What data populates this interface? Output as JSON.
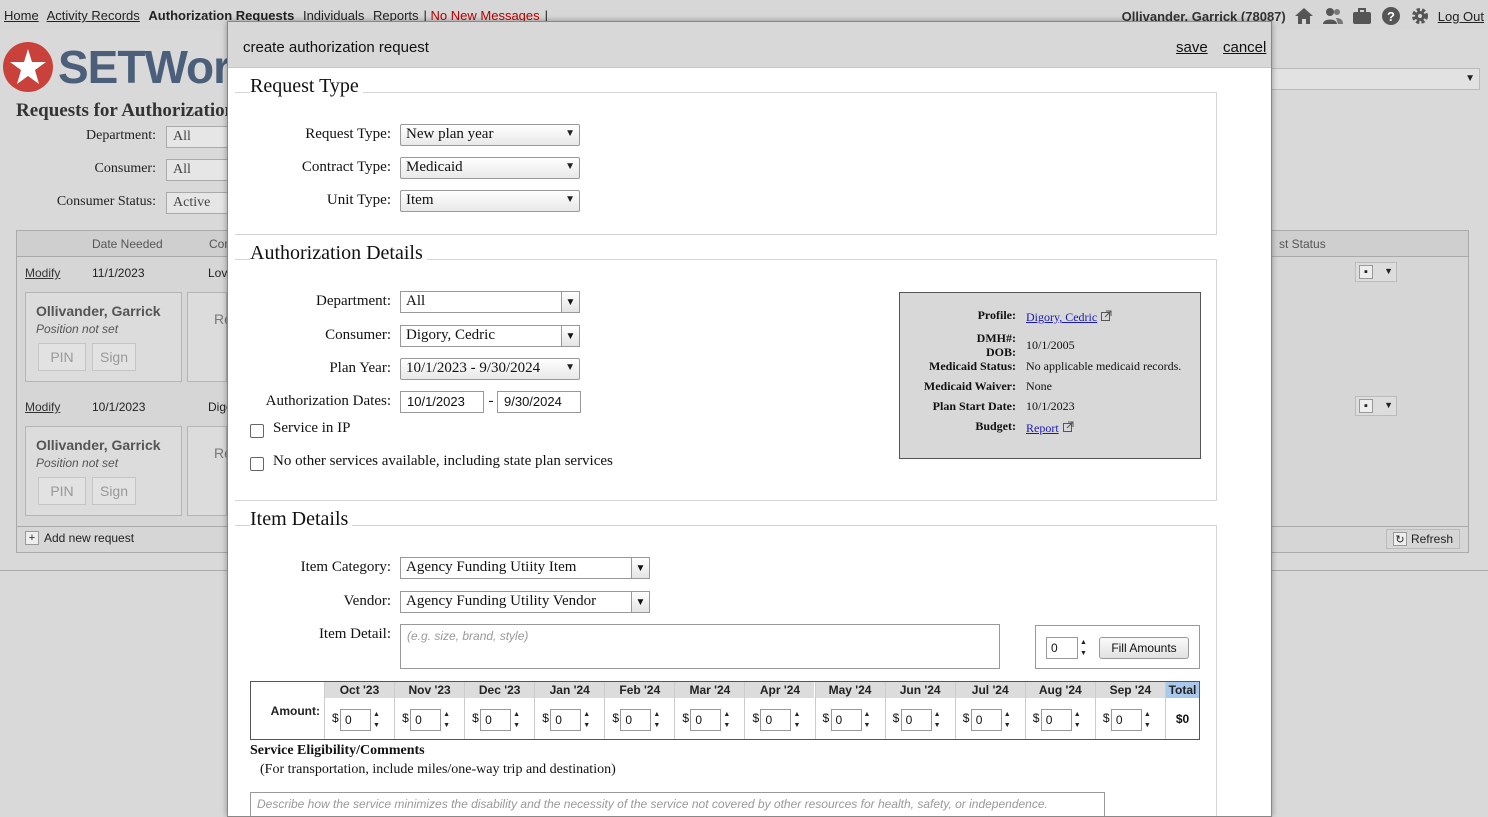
{
  "topnav": {
    "links": [
      "Home",
      "Activity Records",
      "Authorization Requests",
      "Individuals",
      "Reports"
    ],
    "messages": "No New Messages",
    "user": "Ollivander, Garrick",
    "user_id": "(78087)",
    "logout": "Log Out"
  },
  "background": {
    "logo_text": "SETWork",
    "page_title": "Requests for Authorization",
    "filters": [
      {
        "label": "Department:",
        "value": "All"
      },
      {
        "label": "Consumer:",
        "value": "All"
      },
      {
        "label": "Consumer Status:",
        "value": "Active"
      }
    ],
    "columns": {
      "date_needed": "Date Needed",
      "con": "Con",
      "status": "st Status"
    },
    "rows": [
      {
        "action": "Modify",
        "date": "11/1/2023",
        "consumer": "Love",
        "name": "Ollivander, Garrick",
        "position": "Position not set",
        "pin": "PIN",
        "sign": "Sign",
        "other": "Re"
      },
      {
        "action": "Modify",
        "date": "10/1/2023",
        "consumer": "Digo",
        "name": "Ollivander, Garrick",
        "position": "Position not set",
        "pin": "PIN",
        "sign": "Sign",
        "other": "Re"
      }
    ],
    "add_new": "Add new request",
    "refresh": "Refresh"
  },
  "dialog": {
    "title": "create authorization request",
    "save": "save",
    "cancel": "cancel",
    "request_type": {
      "title": "Request Type",
      "request_type_label": "Request Type:",
      "request_type_value": "New plan year",
      "contract_type_label": "Contract Type:",
      "contract_type_value": "Medicaid",
      "unit_type_label": "Unit Type:",
      "unit_type_value": "Item"
    },
    "auth_details": {
      "title": "Authorization Details",
      "department_label": "Department:",
      "department_value": "All",
      "consumer_label": "Consumer:",
      "consumer_value": "Digory, Cedric",
      "plan_year_label": "Plan Year:",
      "plan_year_value": "10/1/2023 - 9/30/2024",
      "auth_dates_label": "Authorization Dates:",
      "auth_start": "10/1/2023",
      "auth_sep": "-",
      "auth_end": "9/30/2024",
      "service_in_ip": "Service in IP",
      "no_other_services": "No other services available, including state plan services",
      "info": {
        "profile_label": "Profile:",
        "profile_value": "Digory, Cedric",
        "dmh_label": "DMH#:",
        "dob_label": "DOB:",
        "dob_value": "10/1/2005",
        "medicaid_status_label": "Medicaid Status:",
        "medicaid_status_value": "No applicable medicaid records.",
        "medicaid_waiver_label": "Medicaid Waiver:",
        "medicaid_waiver_value": "None",
        "plan_start_label": "Plan Start Date:",
        "plan_start_value": "10/1/2023",
        "budget_label": "Budget:",
        "budget_value": "Report"
      }
    },
    "item_details": {
      "title": "Item Details",
      "category_label": "Item Category:",
      "category_value": "Agency Funding Utiity Item",
      "vendor_label": "Vendor:",
      "vendor_value": "Agency Funding Utility Vendor",
      "detail_label": "Item Detail:",
      "detail_placeholder": "(e.g. size, brand, style)",
      "fill_value": "0",
      "fill_button": "Fill Amounts",
      "amount_label": "Amount:",
      "currency": "$",
      "months": [
        {
          "label": "Oct '23",
          "value": "0"
        },
        {
          "label": "Nov '23",
          "value": "0"
        },
        {
          "label": "Dec '23",
          "value": "0"
        },
        {
          "label": "Jan '24",
          "value": "0"
        },
        {
          "label": "Feb '24",
          "value": "0"
        },
        {
          "label": "Mar '24",
          "value": "0"
        },
        {
          "label": "Apr '24",
          "value": "0"
        },
        {
          "label": "May '24",
          "value": "0"
        },
        {
          "label": "Jun '24",
          "value": "0"
        },
        {
          "label": "Jul '24",
          "value": "0"
        },
        {
          "label": "Aug '24",
          "value": "0"
        },
        {
          "label": "Sep '24",
          "value": "0"
        }
      ],
      "total_label": "Total",
      "total_value": "$0"
    },
    "eligibility": {
      "title": "Service Eligibility/Comments",
      "subtitle": "(For transportation, include miles/one-way trip and destination)",
      "placeholder": "Describe how the service minimizes the disability and the necessity of the service not covered by other resources for health, safety, or independence."
    }
  },
  "colors": {
    "accent_link": "#1a1ab0",
    "messages": "#bb0000",
    "total_header": "#a9c9ec"
  },
  "icons": [
    "home-icon",
    "people-icon",
    "briefcase-icon",
    "help-icon",
    "gear-icon",
    "external-link-icon"
  ]
}
